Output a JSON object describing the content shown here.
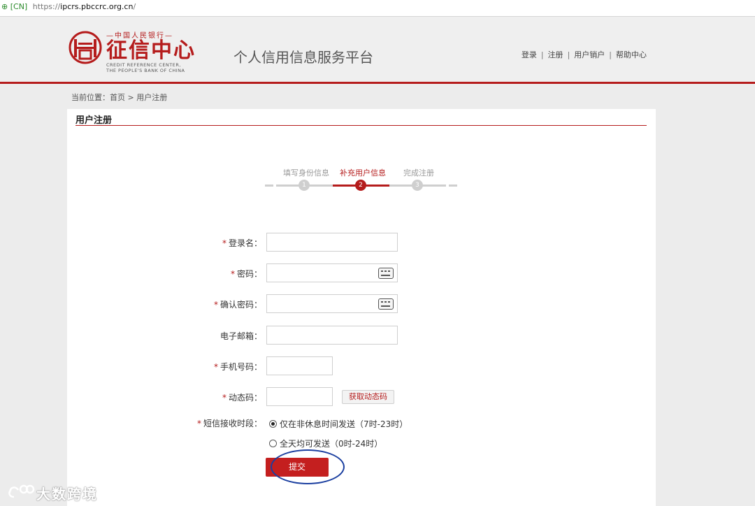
{
  "address_bar": {
    "lock_glyph": "🔒",
    "site_tag": "[CN]",
    "scheme": "https://",
    "host": "ipcrs.pbccrc.org.cn",
    "path": "/"
  },
  "header": {
    "logo_top": "中国人民银行",
    "logo_cn": "征信中心",
    "logo_en_1": "CREDIT REFERENCE CENTER,",
    "logo_en_2": "THE PEOPLE'S BANK OF CHINA",
    "platform_title": "个人信用信息服务平台",
    "nav": [
      "登录",
      "注册",
      "用户销户",
      "帮助中心"
    ]
  },
  "breadcrumb": "当前位置：首页 > 用户注册",
  "panel": {
    "title": "用户注册"
  },
  "steps": [
    {
      "label": "填写身份信息",
      "number": "1",
      "active": false
    },
    {
      "label": "补充用户信息",
      "number": "2",
      "active": true
    },
    {
      "label": "完成注册",
      "number": "3",
      "active": false
    }
  ],
  "form": {
    "login_name": {
      "label": "登录名：",
      "required": true,
      "value": ""
    },
    "password": {
      "label": "密码：",
      "required": true,
      "value": ""
    },
    "confirm_password": {
      "label": "确认密码：",
      "required": true,
      "value": ""
    },
    "email": {
      "label": "电子邮箱：",
      "required": false,
      "value": ""
    },
    "mobile": {
      "label": "手机号码：",
      "required": true,
      "value": ""
    },
    "otp": {
      "label": "动态码：",
      "required": true,
      "value": "",
      "button": "获取动态码"
    },
    "sms_period": {
      "label": "短信接收时段：",
      "required": true,
      "options": [
        "仅在非休息时间发送（7时-23时）",
        "全天均可发送（0时-24时）"
      ],
      "selected": "仅在非休息时间发送（7时-23时）"
    },
    "submit": "提交",
    "required_mark": "*"
  },
  "watermark": "大数跨境",
  "colors": {
    "brand_red": "#b51c1c",
    "submit_red": "#c41f1f",
    "annotation_blue": "#1b3fa0"
  }
}
